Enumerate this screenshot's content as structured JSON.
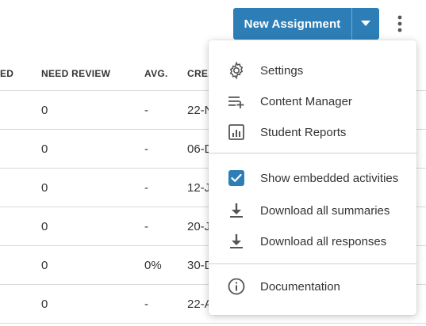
{
  "header": {
    "new_button_label": "New Assignment"
  },
  "table": {
    "headers": {
      "partial": "ED",
      "need_review": "NEED REVIEW",
      "avg": "AVG.",
      "created": "CREA"
    },
    "rows": [
      {
        "need_review": "0",
        "avg": "-",
        "created": "22-N"
      },
      {
        "need_review": "0",
        "avg": "-",
        "created": "06-D"
      },
      {
        "need_review": "0",
        "avg": "-",
        "created": "12-J"
      },
      {
        "need_review": "0",
        "avg": "-",
        "created": "20-J"
      },
      {
        "need_review": "0",
        "avg": "0%",
        "created": "30-D"
      },
      {
        "need_review": "0",
        "avg": "-",
        "created": "22-A"
      }
    ]
  },
  "menu": {
    "items": [
      {
        "label": "Settings",
        "icon": "gear-icon"
      },
      {
        "label": "Content Manager",
        "icon": "playlist-add-icon"
      },
      {
        "label": "Student Reports",
        "icon": "report-chart-icon"
      },
      {
        "label": "Show embedded activities",
        "icon": "checkbox-checked-icon",
        "checked": true
      },
      {
        "label": "Download all summaries",
        "icon": "download-icon"
      },
      {
        "label": "Download all responses",
        "icon": "download-icon"
      },
      {
        "label": "Documentation",
        "icon": "info-icon"
      }
    ]
  },
  "colors": {
    "accent": "#2d7eb6",
    "icon": "#555555",
    "divider": "#d0d0d0"
  }
}
